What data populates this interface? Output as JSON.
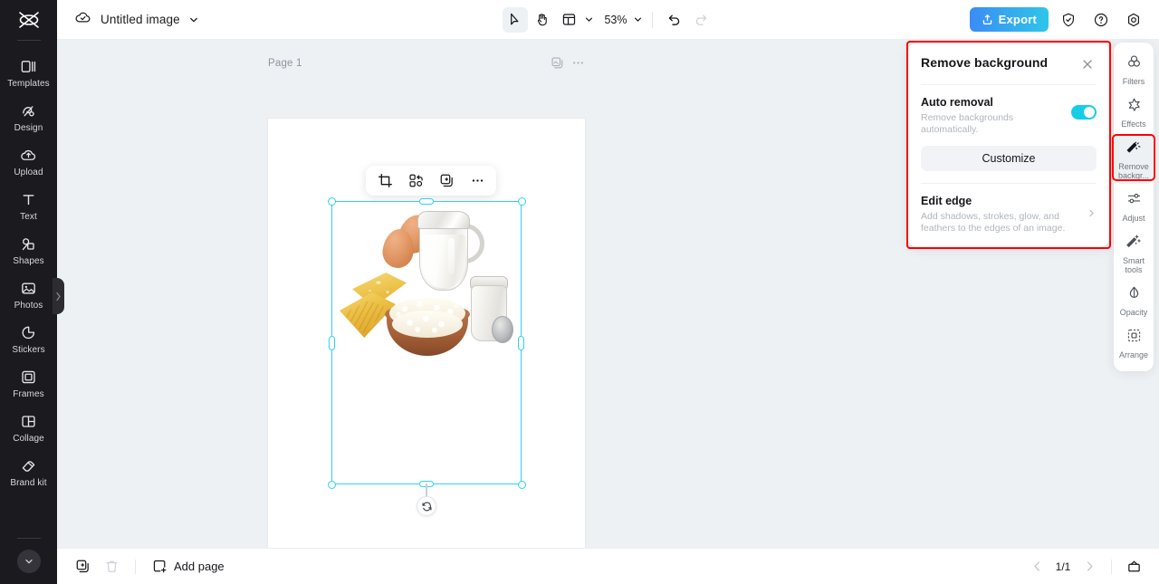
{
  "app": {
    "logo_icon": "capcut-logo-icon"
  },
  "left_sidebar": {
    "items": [
      {
        "label": "Templates",
        "icon": "templates-icon"
      },
      {
        "label": "Design",
        "icon": "design-icon"
      },
      {
        "label": "Upload",
        "icon": "upload-cloud-icon"
      },
      {
        "label": "Text",
        "icon": "text-icon"
      },
      {
        "label": "Shapes",
        "icon": "shapes-icon"
      },
      {
        "label": "Photos",
        "icon": "photos-icon"
      },
      {
        "label": "Stickers",
        "icon": "stickers-icon"
      },
      {
        "label": "Frames",
        "icon": "frames-icon"
      },
      {
        "label": "Collage",
        "icon": "collage-icon"
      },
      {
        "label": "Brand kit",
        "icon": "brand-kit-icon"
      }
    ],
    "expand_icon": "chevron-down-icon",
    "collapse_handle_icon": "chevron-left-icon"
  },
  "topbar": {
    "cloud_icon": "cloud-saved-icon",
    "doc_title": "Untitled image",
    "title_dropdown_icon": "chevron-down-icon",
    "select_tool_icon": "cursor-arrow-icon",
    "hand_tool_icon": "hand-icon",
    "layout_tool_icon": "layout-panel-icon",
    "layout_dropdown_icon": "chevron-down-icon",
    "zoom_level": "53%",
    "zoom_dropdown_icon": "chevron-down-icon",
    "undo_icon": "undo-icon",
    "redo_icon": "redo-icon",
    "export_label": "Export",
    "export_icon": "export-upload-icon",
    "shield_icon": "shield-check-icon",
    "help_icon": "question-circle-icon",
    "settings_icon": "gear-icon"
  },
  "canvas": {
    "page_label": "Page 1",
    "duplicate_page_icon": "duplicate-page-icon",
    "page_more_icon": "more-horizontal-icon",
    "object_toolbar": {
      "crop_icon": "crop-icon",
      "remove_background_icon": "cutout-icon",
      "duplicate_icon": "duplicate-icon",
      "more_icon": "more-horizontal-icon"
    },
    "rotate_icon": "rotate-icon",
    "image_alt": "dairy-products-photo"
  },
  "remove_background_panel": {
    "title": "Remove background",
    "close_icon": "close-icon",
    "auto_removal": {
      "title": "Auto removal",
      "description": "Remove backgrounds automatically.",
      "toggle_on": true,
      "toggle_color": "#16cde8"
    },
    "customize_label": "Customize",
    "edit_edge": {
      "title": "Edit edge",
      "description": "Add shadows, strokes, glow, and feathers to the edges of an image.",
      "chevron_icon": "chevron-right-icon"
    },
    "highlight_color": "#ff0000"
  },
  "right_rail": {
    "items": [
      {
        "label": "Filters",
        "icon": "filters-icon",
        "selected": false
      },
      {
        "label": "Effects",
        "icon": "effects-icon",
        "selected": false
      },
      {
        "label": "Remove backgr...",
        "icon": "remove-background-icon",
        "selected": true
      },
      {
        "label": "Adjust",
        "icon": "adjust-sliders-icon",
        "selected": false
      },
      {
        "label": "Smart tools",
        "icon": "magic-wand-icon",
        "selected": false
      },
      {
        "label": "Opacity",
        "icon": "opacity-drop-icon",
        "selected": false
      },
      {
        "label": "Arrange",
        "icon": "arrange-icon",
        "selected": false
      }
    ],
    "highlight_color": "#ff0000"
  },
  "bottombar": {
    "duplicate_icon": "duplicate-page-icon",
    "delete_icon": "trash-icon",
    "add_page_label": "Add page",
    "add_page_icon": "add-page-icon",
    "prev_page_icon": "chevron-left-icon",
    "page_indicator": "1/1",
    "next_page_icon": "chevron-right-icon",
    "grid_view_icon": "page-grid-icon"
  }
}
